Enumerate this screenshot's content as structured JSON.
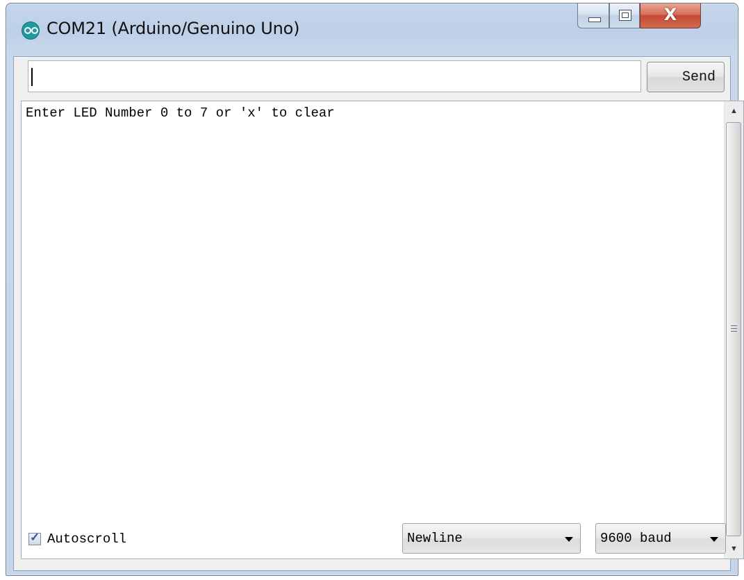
{
  "window": {
    "title": "COM21 (Arduino/Genuino Uno)",
    "close_glyph": "X"
  },
  "input": {
    "value": "",
    "send_label": "Send"
  },
  "output": {
    "lines": [
      "Enter LED Number 0 to 7 or 'x' to clear"
    ]
  },
  "footer": {
    "autoscroll_label": "Autoscroll",
    "autoscroll_checked": true,
    "line_ending": "Newline",
    "baud_rate": "9600 baud"
  },
  "icons": {
    "app": "arduino-logo-icon",
    "minimize": "minimize-icon",
    "maximize": "maximize-icon",
    "close": "close-icon"
  },
  "colors": {
    "arduino_teal": "#1e9aa2",
    "close_red": "#c64a35"
  }
}
